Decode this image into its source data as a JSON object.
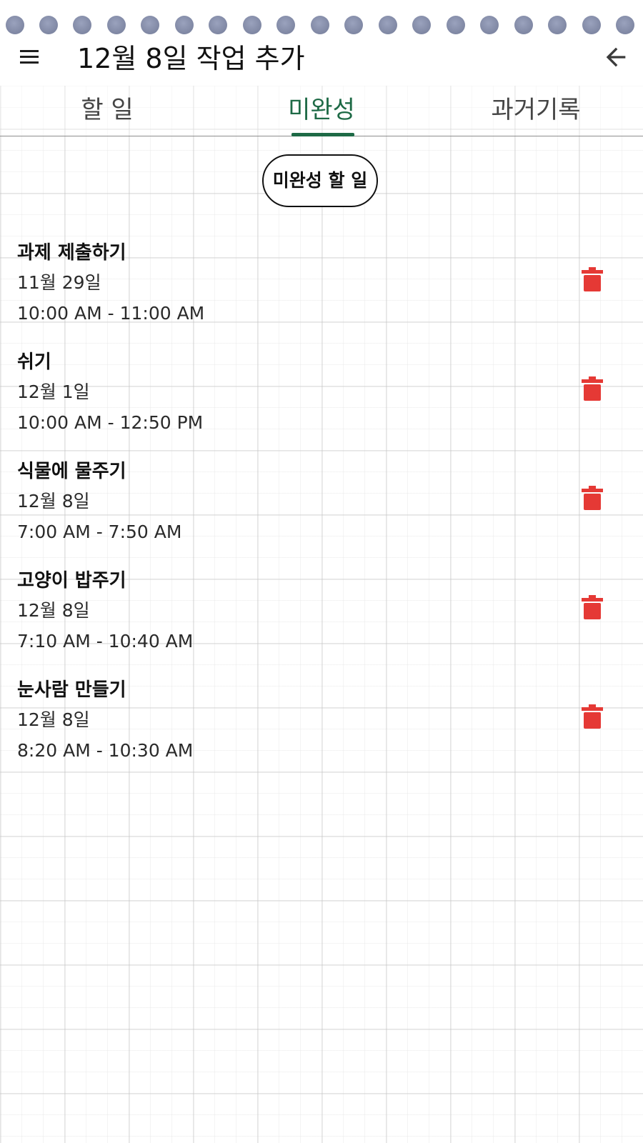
{
  "header": {
    "title": "12월 8일 작업 추가",
    "menu_icon": "hamburger-menu-icon",
    "back_icon": "arrow-left-icon"
  },
  "tabs": [
    {
      "label": "할 일",
      "active": false
    },
    {
      "label": "미완성",
      "active": true
    },
    {
      "label": "과거기록",
      "active": false
    }
  ],
  "section_label": "미완성 할 일",
  "tasks": [
    {
      "title": "과제 제출하기",
      "date": "11월 29일",
      "time": "10:00 AM - 11:00 AM"
    },
    {
      "title": "쉬기",
      "date": "12월 1일",
      "time": "10:00 AM - 12:50 PM"
    },
    {
      "title": "식물에 물주기",
      "date": "12월 8일",
      "time": "7:00 AM - 7:50 AM"
    },
    {
      "title": "고양이 밥주기",
      "date": "12월 8일",
      "time": "7:10 AM - 10:40 AM"
    },
    {
      "title": "눈사람 만들기",
      "date": "12월 8일",
      "time": "8:20 AM - 10:30 AM"
    }
  ],
  "colors": {
    "accent": "#1e6a46",
    "delete": "#e53935",
    "ring": "#858da8"
  }
}
